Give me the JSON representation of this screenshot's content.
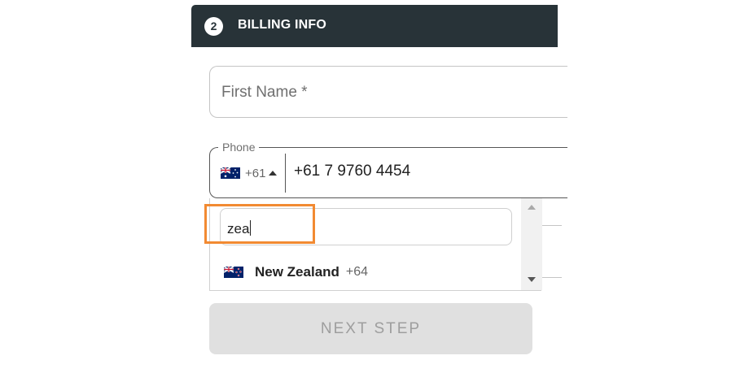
{
  "header": {
    "step_number": "2",
    "title": "BILLING INFO"
  },
  "first_name": {
    "placeholder": "First Name *"
  },
  "phone": {
    "label": "Phone",
    "country_code": "+61",
    "country_flag": "australia-flag-icon",
    "value": "+61 7 9760 4454"
  },
  "country_dropdown": {
    "search_value": "zea",
    "options": [
      {
        "flag": "new-zealand-flag-icon",
        "name": "New Zealand",
        "code": "+64"
      }
    ]
  },
  "next_button": {
    "label": "NEXT STEP"
  },
  "colors": {
    "header_bg": "#283338",
    "highlight": "#f28a32",
    "button_bg": "#e0e0e0",
    "button_text": "#9e9e9e"
  }
}
